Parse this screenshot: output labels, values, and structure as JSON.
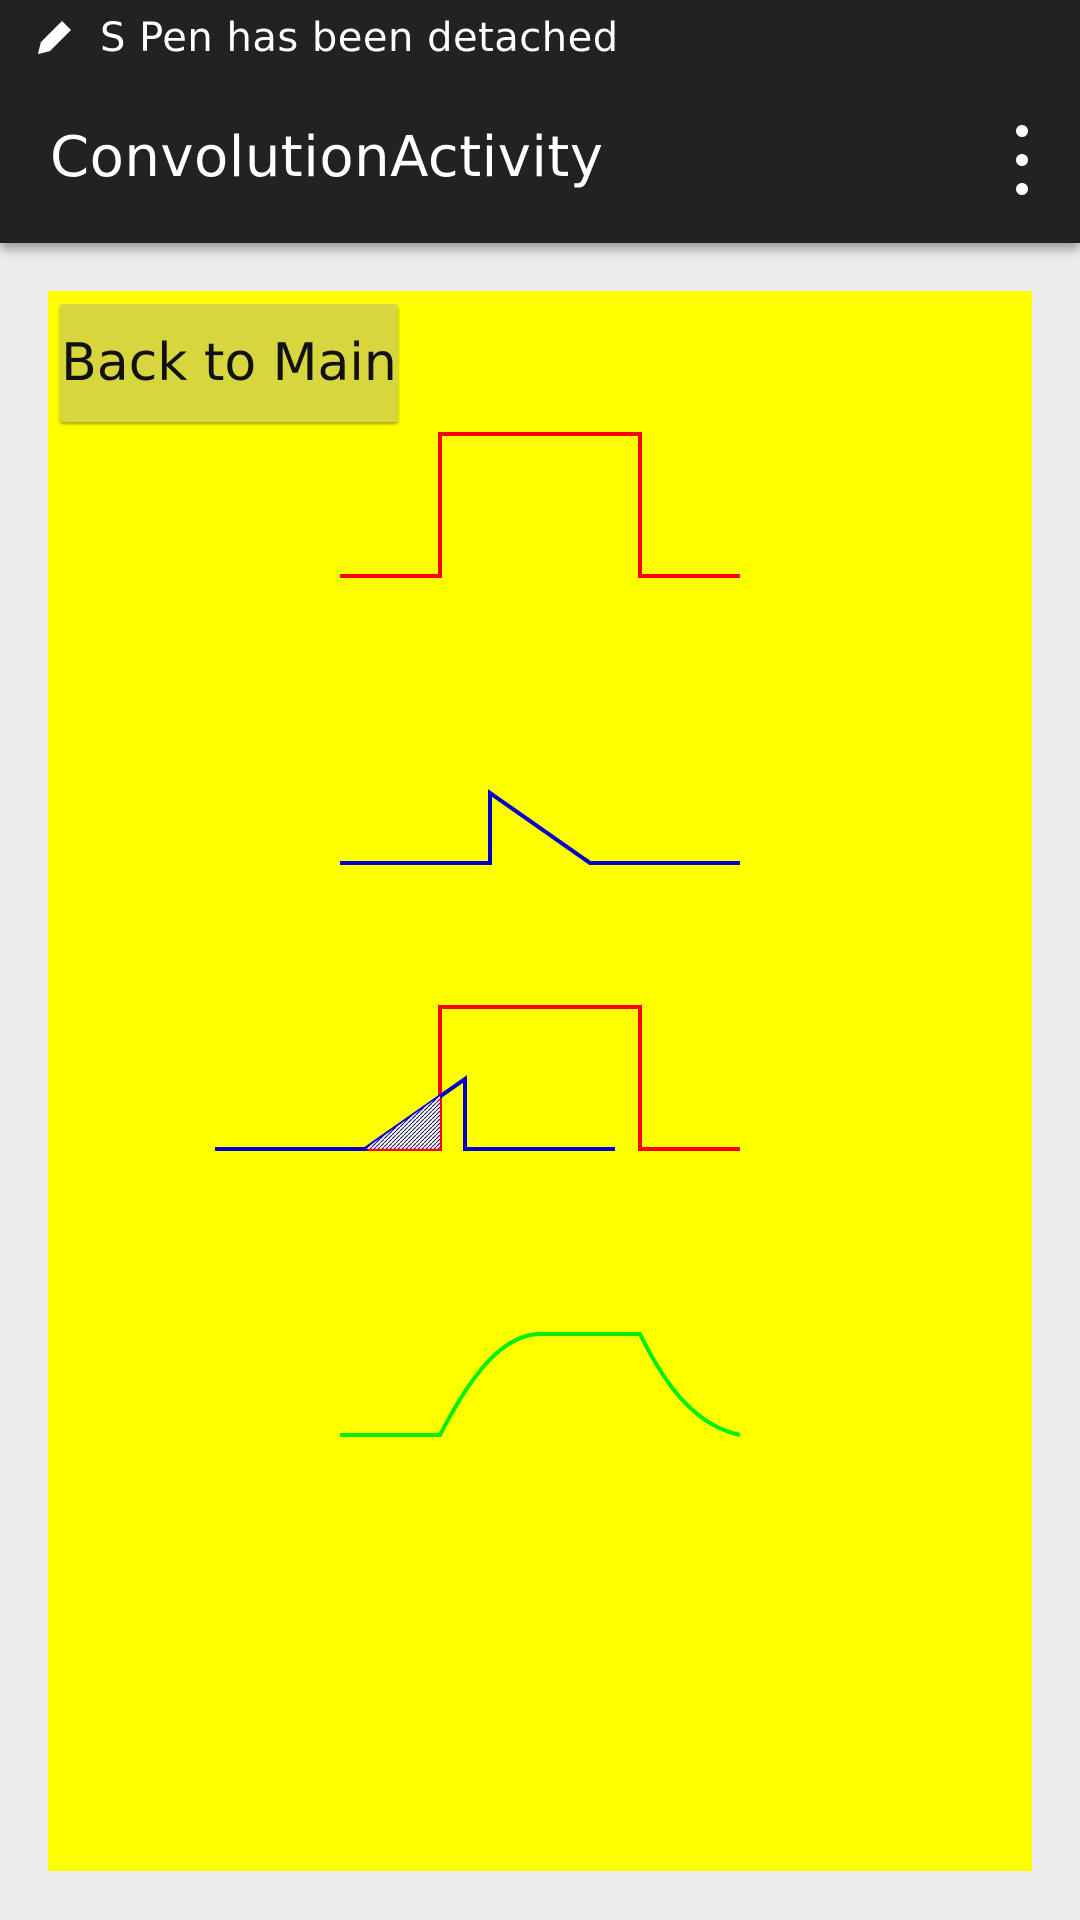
{
  "status_bar": {
    "notification_icon": "pen-icon",
    "notification_text": "S Pen has been detached"
  },
  "action_bar": {
    "title": "ConvolutionActivity",
    "overflow_icon": "more-vert-icon"
  },
  "canvas": {
    "background_color": "#ffff00",
    "back_button_label": "Back to Main"
  },
  "colors": {
    "rect_signal": "#ff0000",
    "triangle_signal": "#0000cc",
    "convolution_result": "#00ee00"
  }
}
